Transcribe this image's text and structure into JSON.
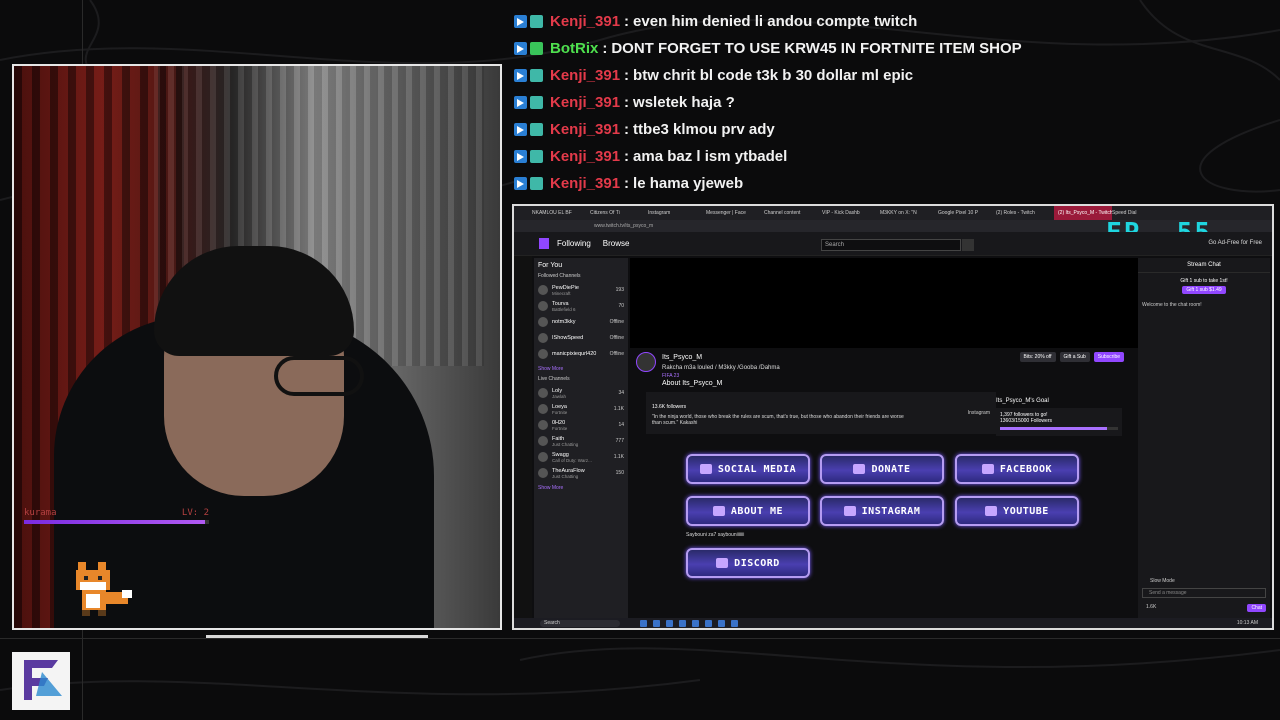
{
  "overlay_chat": [
    {
      "user": "Kenji_391",
      "color": "#e33a4a",
      "badge": "mod",
      "message": "even him denied li andou compte twitch"
    },
    {
      "user": "BotRix",
      "color": "#4ee04e",
      "badge": "verified",
      "message": "DONT FORGET TO USE KRW45 IN FORTNITE ITEM SHOP"
    },
    {
      "user": "Kenji_391",
      "color": "#e33a4a",
      "badge": "mod",
      "message": "btw chrit bl code t3k b 30 dollar ml epic"
    },
    {
      "user": "Kenji_391",
      "color": "#e33a4a",
      "badge": "mod",
      "message": "wsletek haja ?"
    },
    {
      "user": "Kenji_391",
      "color": "#e33a4a",
      "badge": "mod",
      "message": "ttbe3 klmou prv ady"
    },
    {
      "user": "Kenji_391",
      "color": "#e33a4a",
      "badge": "mod",
      "message": "ama baz l ism ytbadel"
    },
    {
      "user": "Kenji_391",
      "color": "#e33a4a",
      "badge": "mod",
      "message": "le hama yjeweb"
    }
  ],
  "webcam": {
    "player_name": "kurama",
    "level_label": "LV: 2",
    "health_fraction": 0.98
  },
  "browser": {
    "tabs": [
      "NKAMLOU EL BF",
      "Citizens Of Ti",
      "Instagram",
      "Messenger | Face",
      "Channel content",
      "VIP - Kick Dashb",
      "M3KKY on X: \"N",
      "Google Pixel 10 P",
      "(2) Roles - Twitch",
      "(2) Its_Psyco_M - Twitch",
      "Speed Dial"
    ],
    "active_tab": 9,
    "url": "www.twitch.tv/its_psyco_m",
    "episode_badge": "EP. 55"
  },
  "twitch_nav": {
    "following": "Following",
    "browse": "Browse",
    "search_placeholder": "Search",
    "ad_free": "Go Ad-Free for Free"
  },
  "sidebar": {
    "for_you": "For You",
    "followed_label": "Followed Channels",
    "followed": [
      {
        "name": "PewDiePie",
        "game": "Minecraft",
        "count": "193"
      },
      {
        "name": "Tourva",
        "game": "Battlefield 6",
        "count": "70"
      },
      {
        "name": "notm3kky",
        "game": "",
        "count": "Offline"
      },
      {
        "name": "IShowSpeed",
        "game": "",
        "count": "Offline"
      },
      {
        "name": "manicpixiequrl420",
        "game": "",
        "count": "Offline"
      }
    ],
    "show_more": "Show More",
    "live_label": "Live Channels",
    "live": [
      {
        "name": "Loly",
        "game": "Jawlah",
        "count": "34"
      },
      {
        "name": "Loeya",
        "game": "Fortnite",
        "count": "1.1K"
      },
      {
        "name": "0H20",
        "game": "Fortnite",
        "count": "14"
      },
      {
        "name": "Faith",
        "game": "Just Chatting",
        "count": "777"
      },
      {
        "name": "Swagg",
        "game": "Call of Duty: Warz...",
        "count": "1.1K"
      },
      {
        "name": "TheAuraFlow",
        "game": "Just Chatting",
        "count": "150"
      }
    ],
    "show_more_2": "Show More"
  },
  "channel": {
    "name": "Its_Psyco_M",
    "title": "Rakcha m3a louled / M3kky /Gooba /Dahma",
    "game": "FIFA 23",
    "bits": "Bits: 20% off",
    "gift_sub": "Gift a Sub",
    "subscribe": "Subscribe",
    "about_title": "About Its_Psyco_M",
    "followers": "13.6K followers",
    "quote": "\"In the ninja world, those who break the rules are scum, that's true, but those who abandon their friends are worse than scum.\" Kakashi",
    "instagram": "Instagram",
    "goal_title": "Its_Psyco_M's Goal",
    "goal_headline": "1,397 followers to go!",
    "goal_progress_text": "13603/15000 Followers",
    "goal_fraction": 0.907
  },
  "panels": {
    "social_media": "SOCIAL MEDIA",
    "donate": "DONATE",
    "facebook": "FACEBOOK",
    "about_me": "ABOUT ME",
    "instagram": "INSTAGRAM",
    "youtube": "YOUTUBE",
    "discord": "DISCORD",
    "tag": "Saybouni za7 saybouniiiiiii"
  },
  "stream_chat": {
    "header": "Stream Chat",
    "gift_text": "Gift 1 sub to take 1st!",
    "gift_btn": "Gift 1 sub",
    "gift_price": "$1.49",
    "welcome": "Welcome to the chat room!",
    "slow_mode": "Slow Mode",
    "placeholder": "Send a message",
    "points": "1.6K",
    "chat_btn": "Chat"
  },
  "taskbar": {
    "search": "Search",
    "clock": "10:13 AM"
  }
}
